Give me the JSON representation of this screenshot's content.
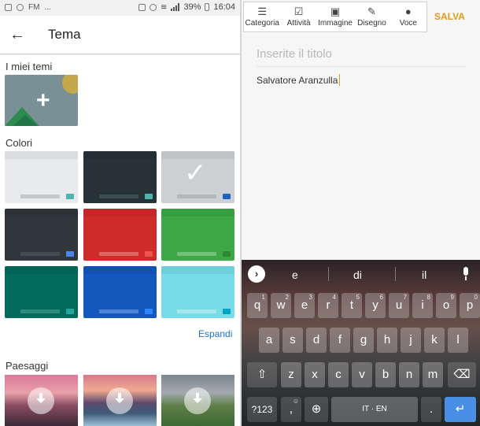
{
  "status_bar": {
    "left_text": "FM",
    "left_dots": "...",
    "battery": "39%",
    "time": "16:04"
  },
  "left_header": {
    "title": "Tema"
  },
  "sections": {
    "my_themes": "I miei temi",
    "colors": "Colori",
    "landscapes": "Paesaggi",
    "expand": "Espandi"
  },
  "color_tiles": [
    {
      "bg": "#e8eaed",
      "bar": "#c4c7cb",
      "key": "#4db6ac",
      "selected": false
    },
    {
      "bg": "#263238",
      "bar": "#3d4b52",
      "key": "#4db6ac",
      "selected": false
    },
    {
      "bg": "#cdd0d3",
      "bar": "#b4b7ba",
      "key": "#1e63c4",
      "selected": true
    },
    {
      "bg": "#31363b",
      "bar": "#464c52",
      "key": "#4a86e8",
      "selected": false
    },
    {
      "bg": "#cf2b2b",
      "bar": "#e06262",
      "key": "#ef5350",
      "selected": false
    },
    {
      "bg": "#3da845",
      "bar": "#71c277",
      "key": "#2b8a32",
      "selected": false
    },
    {
      "bg": "#036b5c",
      "bar": "#2f8a7e",
      "key": "#26a69a",
      "selected": false
    },
    {
      "bg": "#1457bd",
      "bar": "#4f83d3",
      "key": "#2e86ff",
      "selected": false
    },
    {
      "bg": "#77dbe8",
      "bar": "#a6e7ef",
      "key": "#00a6c0",
      "selected": false
    }
  ],
  "note_toolbar": {
    "items": [
      {
        "label": "Categoria",
        "icon": "list-icon"
      },
      {
        "label": "Attività",
        "icon": "checkbox-icon"
      },
      {
        "label": "Immagine",
        "icon": "image-icon"
      },
      {
        "label": "Disegno",
        "icon": "pencil-icon"
      },
      {
        "label": "Voce",
        "icon": "mic-icon"
      }
    ],
    "save_label": "SALVA"
  },
  "note": {
    "title_placeholder": "Inserite il titolo",
    "body": "Salvatore Aranzulla"
  },
  "keyboard": {
    "suggestions": [
      "e",
      "di",
      "il"
    ],
    "row1": [
      {
        "k": "q",
        "h": "1"
      },
      {
        "k": "w",
        "h": "2"
      },
      {
        "k": "e",
        "h": "3"
      },
      {
        "k": "r",
        "h": "4"
      },
      {
        "k": "t",
        "h": "5"
      },
      {
        "k": "y",
        "h": "6"
      },
      {
        "k": "u",
        "h": "7"
      },
      {
        "k": "i",
        "h": "8"
      },
      {
        "k": "o",
        "h": "9"
      },
      {
        "k": "p",
        "h": "0"
      }
    ],
    "row2": [
      "a",
      "s",
      "d",
      "f",
      "g",
      "h",
      "j",
      "k",
      "l"
    ],
    "row3": [
      "z",
      "x",
      "c",
      "v",
      "b",
      "n",
      "m"
    ],
    "symbols_key": "?123",
    "comma": ",",
    "comma_hint": "☺",
    "space_label": "IT · EN",
    "period": "."
  },
  "colors": {
    "accent_orange": "#e39b16",
    "link_blue": "#1a73c8",
    "enter_blue": "#4a8fe6"
  }
}
